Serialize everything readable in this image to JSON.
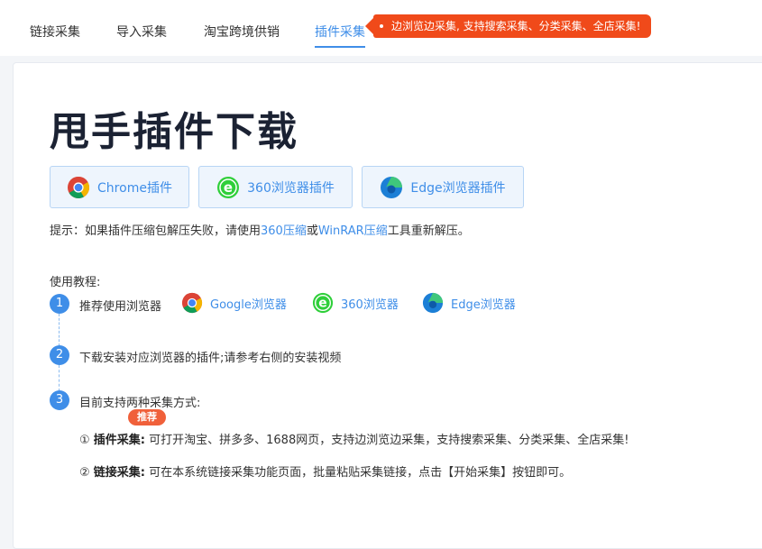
{
  "tabs": [
    {
      "label": "链接采集"
    },
    {
      "label": "导入采集"
    },
    {
      "label": "淘宝跨境供销"
    },
    {
      "label": "插件采集"
    }
  ],
  "promo_text": "边浏览边采集, 支持搜索采集、分类采集、全店采集!",
  "page_title": "甩手插件下载",
  "downloads": [
    {
      "label": "Chrome插件",
      "icon": "chrome-icon"
    },
    {
      "label": "360浏览器插件",
      "icon": "360-browser-icon"
    },
    {
      "label": "Edge浏览器插件",
      "icon": "edge-icon"
    }
  ],
  "tip": {
    "prefix": "提示：如果插件压缩包解压失败，请使用",
    "link1": "360压缩",
    "mid": "或",
    "link2": "WinRAR压缩",
    "suffix": "工具重新解压。"
  },
  "tutorial": {
    "label": "使用教程:",
    "steps": [
      {
        "num": "1",
        "text": "推荐使用浏览器"
      },
      {
        "num": "2",
        "text": "下载安装对应浏览器的插件;请参考右侧的安装视频"
      },
      {
        "num": "3",
        "text": "目前支持两种采集方式:"
      }
    ],
    "browsers": [
      {
        "label": "Google浏览器",
        "icon": "chrome-icon"
      },
      {
        "label": "360浏览器",
        "icon": "360-browser-icon"
      },
      {
        "label": "Edge浏览器",
        "icon": "edge-icon"
      }
    ],
    "recommend_badge": "推荐",
    "methods": [
      {
        "marker": "①",
        "name": "插件采集:",
        "desc": "可打开淘宝、拼多多、1688网页，支持边浏览边采集，支持搜索采集、分类采集、全店采集!"
      },
      {
        "marker": "②",
        "name": "链接采集:",
        "desc": "可在本系统链接采集功能页面，批量粘贴采集链接，点击【开始采集】按钮即可。"
      }
    ]
  },
  "colors": {
    "accent": "#3f8ee8",
    "promo": "#f04a1a",
    "badge": "#f0603a",
    "title": "#1b2233"
  }
}
